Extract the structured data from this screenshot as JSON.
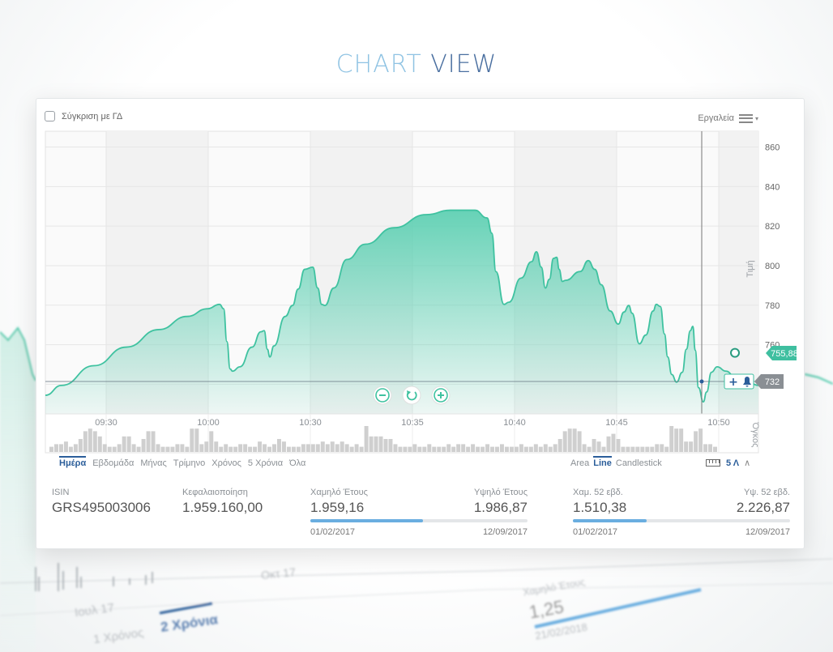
{
  "page_title": {
    "part1": "CHART",
    "part2": "VIEW"
  },
  "toolbar": {
    "compare_label": "Σύγκριση με ΓΔ",
    "tools_label": "Εργαλεία"
  },
  "colors": {
    "accent": "#4cc9aa",
    "line": "#3fc2a0",
    "active": "#2b5e9a",
    "price_tag": "#3fbfa0",
    "last_tag": "#8a8f94",
    "volume_bar": "#cfcfcf"
  },
  "chart_data": {
    "type": "area",
    "x_ticks": [
      "09:30",
      "10:00",
      "10:30",
      "10:35",
      "10:40",
      "10:45",
      "10:50"
    ],
    "y_ticks": [
      860,
      840,
      820,
      800,
      780,
      760,
      740
    ],
    "ylim": [
      725,
      868
    ],
    "ylabel": "Τιμή",
    "volume_label": "Όγκος",
    "current_price_label": "755,88",
    "current_price": 755.88,
    "reference_label": "732",
    "reference_value": 732,
    "price_series": [
      {
        "x": 0,
        "y": 757
      },
      {
        "x": 20,
        "y": 766
      },
      {
        "x": 60,
        "y": 784
      },
      {
        "x": 100,
        "y": 801
      },
      {
        "x": 140,
        "y": 817
      },
      {
        "x": 175,
        "y": 829
      },
      {
        "x": 200,
        "y": 836
      },
      {
        "x": 215,
        "y": 840
      },
      {
        "x": 220,
        "y": 836
      },
      {
        "x": 224,
        "y": 806
      },
      {
        "x": 228,
        "y": 781
      },
      {
        "x": 231,
        "y": 779
      },
      {
        "x": 240,
        "y": 783
      },
      {
        "x": 255,
        "y": 801
      },
      {
        "x": 266,
        "y": 815
      },
      {
        "x": 270,
        "y": 816
      },
      {
        "x": 274,
        "y": 799
      },
      {
        "x": 277,
        "y": 792
      },
      {
        "x": 282,
        "y": 802
      },
      {
        "x": 296,
        "y": 829
      },
      {
        "x": 305,
        "y": 839
      },
      {
        "x": 312,
        "y": 854
      },
      {
        "x": 320,
        "y": 872
      },
      {
        "x": 330,
        "y": 874
      },
      {
        "x": 336,
        "y": 855
      },
      {
        "x": 341,
        "y": 840
      },
      {
        "x": 345,
        "y": 839
      },
      {
        "x": 356,
        "y": 855
      },
      {
        "x": 372,
        "y": 881
      },
      {
        "x": 395,
        "y": 895
      },
      {
        "x": 430,
        "y": 910
      },
      {
        "x": 470,
        "y": 922
      },
      {
        "x": 500,
        "y": 926
      },
      {
        "x": 530,
        "y": 926
      },
      {
        "x": 545,
        "y": 919
      },
      {
        "x": 551,
        "y": 905
      },
      {
        "x": 556,
        "y": 870
      },
      {
        "x": 566,
        "y": 840
      },
      {
        "x": 572,
        "y": 842
      },
      {
        "x": 587,
        "y": 864
      },
      {
        "x": 600,
        "y": 879
      },
      {
        "x": 606,
        "y": 888
      },
      {
        "x": 612,
        "y": 874
      },
      {
        "x": 617,
        "y": 855
      },
      {
        "x": 622,
        "y": 863
      },
      {
        "x": 627,
        "y": 882
      },
      {
        "x": 631,
        "y": 883
      },
      {
        "x": 634,
        "y": 872
      },
      {
        "x": 638,
        "y": 861
      },
      {
        "x": 642,
        "y": 862
      },
      {
        "x": 660,
        "y": 870
      },
      {
        "x": 670,
        "y": 880
      },
      {
        "x": 678,
        "y": 872
      },
      {
        "x": 686,
        "y": 858
      },
      {
        "x": 697,
        "y": 834
      },
      {
        "x": 707,
        "y": 822
      },
      {
        "x": 714,
        "y": 833
      },
      {
        "x": 720,
        "y": 839
      },
      {
        "x": 724,
        "y": 832
      },
      {
        "x": 733,
        "y": 804
      },
      {
        "x": 741,
        "y": 812
      },
      {
        "x": 750,
        "y": 834
      },
      {
        "x": 754,
        "y": 840
      },
      {
        "x": 759,
        "y": 838
      },
      {
        "x": 764,
        "y": 813
      },
      {
        "x": 768,
        "y": 792
      },
      {
        "x": 773,
        "y": 776
      },
      {
        "x": 779,
        "y": 769
      },
      {
        "x": 786,
        "y": 778
      },
      {
        "x": 791,
        "y": 799
      },
      {
        "x": 796,
        "y": 816
      },
      {
        "x": 799,
        "y": 820
      },
      {
        "x": 802,
        "y": 798
      },
      {
        "x": 806,
        "y": 764
      },
      {
        "x": 812,
        "y": 751
      },
      {
        "x": 816,
        "y": 760
      },
      {
        "x": 822,
        "y": 778
      },
      {
        "x": 829,
        "y": 783
      },
      {
        "x": 840,
        "y": 779
      },
      {
        "x": 851,
        "y": 774
      },
      {
        "x": 858,
        "y": 771
      },
      {
        "x": 865,
        "y": 770
      },
      {
        "x": 880,
        "y": 766
      }
    ],
    "volume_levels": [
      2,
      3,
      3,
      4,
      2,
      3,
      5,
      8,
      9,
      8,
      6,
      3,
      2,
      2,
      3,
      6,
      6,
      3,
      2,
      5,
      8,
      8,
      3,
      2,
      2,
      2,
      3,
      3,
      2,
      9,
      9,
      3,
      4,
      8,
      4,
      2,
      3,
      2,
      2,
      3,
      3,
      2,
      2,
      4,
      3,
      2,
      3,
      5,
      4,
      2,
      2,
      2,
      3,
      3,
      3,
      3,
      4,
      3,
      4,
      3,
      4,
      3,
      2,
      3,
      2,
      10,
      6,
      6,
      6,
      5,
      5,
      3,
      2,
      2,
      2,
      3,
      2,
      2,
      3,
      2,
      2,
      2,
      3,
      2,
      3,
      3,
      2,
      3,
      2,
      2,
      3,
      2,
      2,
      3,
      2,
      2,
      2,
      3,
      2,
      2,
      3,
      2,
      3,
      2,
      3,
      5,
      8,
      9,
      9,
      8,
      3,
      2,
      5,
      4,
      2,
      6,
      7,
      5,
      2,
      2,
      2,
      2,
      2,
      2,
      2,
      3,
      3,
      2,
      10,
      9,
      9,
      4,
      4,
      8,
      9,
      3,
      3,
      2
    ]
  },
  "chart_controls": {
    "zoom_out": "−",
    "reset": "↺",
    "zoom_in": "+"
  },
  "periods": [
    "Ημέρα",
    "Εβδομάδα",
    "Μήνας",
    "Τρίμηνο",
    "Χρόνος",
    "5 Χρόνια",
    "Όλα"
  ],
  "active_period_index": 0,
  "chart_types": [
    "Area",
    "Line",
    "Candlestick"
  ],
  "active_chart_type_index": 1,
  "zoom_label": "5 Λ",
  "stats": {
    "isin_label": "ISIN",
    "isin_value": "GRS495003006",
    "cap_label": "Κεφαλαιοποίηση",
    "cap_value": "1.959.160,00",
    "year": {
      "low_label": "Χαμηλό Έτους",
      "low_value": "1.959,16",
      "low_date": "01/02/2017",
      "high_label": "Υψηλό Έτους",
      "high_value": "1.986,87",
      "high_date": "12/09/2017",
      "progress": 0.52
    },
    "week52": {
      "low_label": "Χαμ. 52 εβδ.",
      "low_value": "1.510,38",
      "low_date": "01/02/2017",
      "high_label": "Υψ. 52 εβδ.",
      "high_value": "2.226,87",
      "high_date": "12/09/2017",
      "progress": 0.34
    }
  },
  "background": {
    "labels": [
      "Οκτ 17",
      "Ιουλ 17",
      "1 Χρόνος",
      "2 Χρόνια",
      "Χαμηλό Έτους",
      "1,25",
      "21/02/2018"
    ]
  }
}
